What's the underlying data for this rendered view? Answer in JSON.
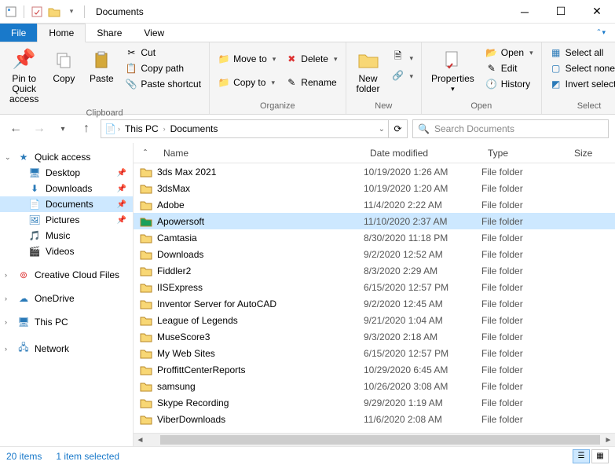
{
  "window": {
    "title": "Documents"
  },
  "tabs": {
    "file": "File",
    "home": "Home",
    "share": "Share",
    "view": "View"
  },
  "ribbon": {
    "clipboard": {
      "label": "Clipboard",
      "pinToQuick": "Pin to Quick\naccess",
      "copy": "Copy",
      "paste": "Paste",
      "cut": "Cut",
      "copyPath": "Copy path",
      "pasteShortcut": "Paste shortcut"
    },
    "organize": {
      "label": "Organize",
      "moveTo": "Move to",
      "copyTo": "Copy to",
      "delete": "Delete",
      "rename": "Rename"
    },
    "new": {
      "label": "New",
      "newFolder": "New\nfolder"
    },
    "open": {
      "label": "Open",
      "properties": "Properties",
      "open": "Open",
      "edit": "Edit",
      "history": "History"
    },
    "select": {
      "label": "Select",
      "selectAll": "Select all",
      "selectNone": "Select none",
      "invert": "Invert selection"
    }
  },
  "breadcrumb": {
    "pc": "This PC",
    "loc": "Documents"
  },
  "search": {
    "placeholder": "Search Documents"
  },
  "sidebar": {
    "quickAccess": "Quick access",
    "desktop": "Desktop",
    "downloads": "Downloads",
    "documents": "Documents",
    "pictures": "Pictures",
    "music": "Music",
    "videos": "Videos",
    "ccf": "Creative Cloud Files",
    "onedrive": "OneDrive",
    "thispc": "This PC",
    "network": "Network"
  },
  "columns": {
    "name": "Name",
    "date": "Date modified",
    "type": "Type",
    "size": "Size"
  },
  "files": [
    {
      "name": "3ds Max 2021",
      "date": "10/19/2020 1:26 AM",
      "type": "File folder",
      "selected": false,
      "iconColor": "#f8d775"
    },
    {
      "name": "3dsMax",
      "date": "10/19/2020 1:20 AM",
      "type": "File folder",
      "selected": false,
      "iconColor": "#f8d775"
    },
    {
      "name": "Adobe",
      "date": "11/4/2020 2:22 AM",
      "type": "File folder",
      "selected": false,
      "iconColor": "#f8d775"
    },
    {
      "name": "Apowersoft",
      "date": "11/10/2020 2:37 AM",
      "type": "File folder",
      "selected": true,
      "iconColor": "#1aa05c"
    },
    {
      "name": "Camtasia",
      "date": "8/30/2020 11:18 PM",
      "type": "File folder",
      "selected": false,
      "iconColor": "#f8d775"
    },
    {
      "name": "Downloads",
      "date": "9/2/2020 12:52 AM",
      "type": "File folder",
      "selected": false,
      "iconColor": "#f8d775"
    },
    {
      "name": "Fiddler2",
      "date": "8/3/2020 2:29 AM",
      "type": "File folder",
      "selected": false,
      "iconColor": "#f8d775"
    },
    {
      "name": "IISExpress",
      "date": "6/15/2020 12:57 PM",
      "type": "File folder",
      "selected": false,
      "iconColor": "#f8d775"
    },
    {
      "name": "Inventor Server for AutoCAD",
      "date": "9/2/2020 12:45 AM",
      "type": "File folder",
      "selected": false,
      "iconColor": "#f8d775"
    },
    {
      "name": "League of Legends",
      "date": "9/21/2020 1:04 AM",
      "type": "File folder",
      "selected": false,
      "iconColor": "#f8d775"
    },
    {
      "name": "MuseScore3",
      "date": "9/3/2020 2:18 AM",
      "type": "File folder",
      "selected": false,
      "iconColor": "#f8d775"
    },
    {
      "name": "My Web Sites",
      "date": "6/15/2020 12:57 PM",
      "type": "File folder",
      "selected": false,
      "iconColor": "#f8d775"
    },
    {
      "name": "ProffittCenterReports",
      "date": "10/29/2020 6:45 AM",
      "type": "File folder",
      "selected": false,
      "iconColor": "#f8d775"
    },
    {
      "name": "samsung",
      "date": "10/26/2020 3:08 AM",
      "type": "File folder",
      "selected": false,
      "iconColor": "#f8d775"
    },
    {
      "name": "Skype Recording",
      "date": "9/29/2020 1:19 AM",
      "type": "File folder",
      "selected": false,
      "iconColor": "#f8d775"
    },
    {
      "name": "ViberDownloads",
      "date": "11/6/2020 2:08 AM",
      "type": "File folder",
      "selected": false,
      "iconColor": "#f8d775"
    }
  ],
  "status": {
    "count": "20 items",
    "selected": "1 item selected"
  }
}
